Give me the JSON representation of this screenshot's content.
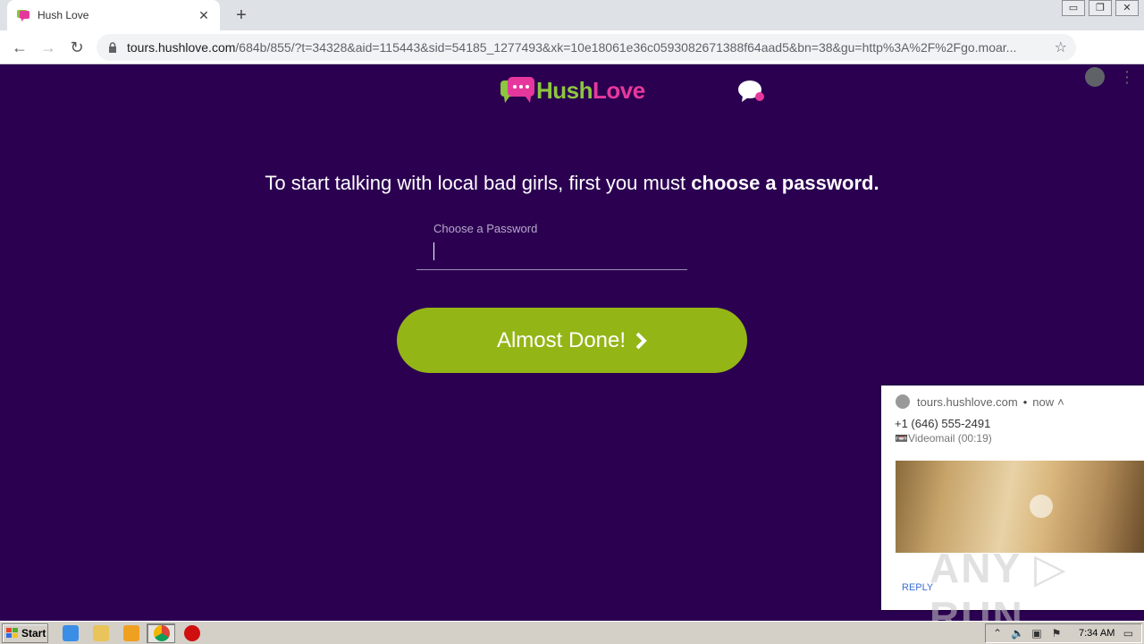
{
  "browser": {
    "tab_title": "Hush Love",
    "tab_close": "✕",
    "new_tab": "+",
    "url_host": "tours.hushlove.com",
    "url_path": "/684b/855/?t=34328&aid=115443&sid=54185_1277493&xk=10e18061e36c0593082671388f64aad5&bn=38&gu=http%3A%2F%2Fgo.moar...",
    "window_controls": [
      "▭",
      "❐",
      "✕"
    ]
  },
  "logo": {
    "hush": "Hush",
    "love": "Love"
  },
  "page": {
    "headline_plain": "To start talking with local bad girls, first you must ",
    "headline_bold": "choose a password.",
    "password_label": "Choose a Password",
    "password_value": "",
    "cta_label": "Almost Done!"
  },
  "notification": {
    "source": "tours.hushlove.com",
    "separator": "•",
    "time": "now",
    "expand": "˄",
    "phone": "+1 (646) 555-2491",
    "voicemail": "📼Videomail (00:19)",
    "reply": "REPLY"
  },
  "watermark": "ANY ▷ RUN",
  "taskbar": {
    "start_label": "Start",
    "clock": "7:34 AM"
  },
  "colors": {
    "page_bg": "#2b0051",
    "cta": "#94b516",
    "logo_green": "#8dc63f",
    "logo_pink": "#e6389c"
  }
}
